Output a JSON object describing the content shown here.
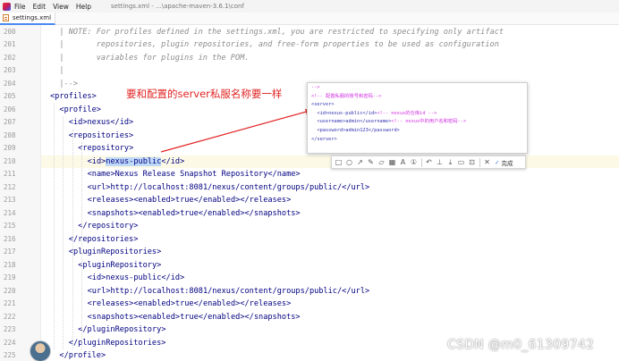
{
  "menubar": {
    "items": [
      "File",
      "Edit",
      "View",
      "Help"
    ],
    "window_title": "settings.xml - ...\\apache-maven-3.6.1\\conf"
  },
  "tab": {
    "label": "settings.xml"
  },
  "annotation": {
    "text": "要和配置的server私服名称要一样"
  },
  "popup": {
    "lines": [
      {
        "kind": "c",
        "text": "-->"
      },
      {
        "kind": "c",
        "text": "<!-- 配置私服的账号和密码-->"
      },
      {
        "kind": "t",
        "text": "<server>"
      },
      {
        "kind": "m",
        "text": "  <id>nexus-public</id>",
        "comment": "<!-- nexus的仓库id -->"
      },
      {
        "kind": "m",
        "text": "  <username>admin</username>",
        "comment": "<!-- nexus中的用户名和密码-->"
      },
      {
        "kind": "t",
        "text": "  <password>admin123</password>"
      },
      {
        "kind": "t",
        "text": "</server>"
      }
    ]
  },
  "toolbar": {
    "tools": [
      "rect-icon",
      "circle-icon",
      "arrow-icon",
      "pen-icon",
      "marker-icon",
      "mosaic-icon",
      "text-icon",
      "sequence-icon",
      "undo-icon",
      "pin-icon",
      "download-icon",
      "save-icon",
      "ocr-icon",
      "close-icon"
    ],
    "tool_glyphs": [
      "□",
      "○",
      "↗",
      "✎",
      "▱",
      "▦",
      "A",
      "①",
      "↶",
      "⊥",
      "⤓",
      "▭",
      "⊡",
      "✕"
    ],
    "done_label": "完成"
  },
  "code": {
    "lines": [
      {
        "num": "200",
        "indent": 0,
        "text": "  | NOTE: For profiles defined in the settings.xml, you are restricted to specifying only artifact",
        "type": "comment"
      },
      {
        "num": "201",
        "indent": 0,
        "text": "  |       repositories, plugin repositories, and free-form properties to be used as configuration",
        "type": "comment"
      },
      {
        "num": "202",
        "indent": 0,
        "text": "  |       variables for plugins in the POM.",
        "type": "comment"
      },
      {
        "num": "203",
        "indent": 0,
        "text": "  |",
        "type": "comment"
      },
      {
        "num": "204",
        "indent": 0,
        "text": "  |-->",
        "type": "comment"
      },
      {
        "num": "205",
        "indent": 0,
        "text": "<profiles>",
        "type": "tag"
      },
      {
        "num": "206",
        "indent": 1,
        "text": "<profile>",
        "type": "tag"
      },
      {
        "num": "207",
        "indent": 2,
        "text": "<id>nexus</id>",
        "type": "tag"
      },
      {
        "num": "208",
        "indent": 2,
        "text": "<repositories>",
        "type": "tag"
      },
      {
        "num": "209",
        "indent": 3,
        "text": "<repository>",
        "type": "tag"
      },
      {
        "num": "210",
        "indent": 4,
        "pre": "<id>",
        "hl": "nexus-public",
        "post": "</id>",
        "type": "tag"
      },
      {
        "num": "211",
        "indent": 4,
        "text": "<name>Nexus Release Snapshot Repository</name>",
        "type": "tag"
      },
      {
        "num": "212",
        "indent": 4,
        "text": "<url>http://localhost:8081/nexus/content/groups/public/</url>",
        "type": "tag"
      },
      {
        "num": "213",
        "indent": 4,
        "text": "<releases><enabled>true</enabled></releases>",
        "type": "tag"
      },
      {
        "num": "214",
        "indent": 4,
        "text": "<snapshots><enabled>true</enabled></snapshots>",
        "type": "tag"
      },
      {
        "num": "215",
        "indent": 3,
        "text": "</repository>",
        "type": "tag"
      },
      {
        "num": "216",
        "indent": 2,
        "text": "</repositories>",
        "type": "tag"
      },
      {
        "num": "217",
        "indent": 2,
        "text": "<pluginRepositories>",
        "type": "tag"
      },
      {
        "num": "218",
        "indent": 3,
        "text": "<pluginRepository>",
        "type": "tag"
      },
      {
        "num": "219",
        "indent": 4,
        "text": "<id>nexus-public</id>",
        "type": "tag"
      },
      {
        "num": "220",
        "indent": 4,
        "text": "<url>http://localhost:8081/nexus/content/groups/public/</url>",
        "type": "tag"
      },
      {
        "num": "221",
        "indent": 4,
        "text": "<releases><enabled>true</enabled></releases>",
        "type": "tag"
      },
      {
        "num": "222",
        "indent": 4,
        "text": "<snapshots><enabled>true</enabled></snapshots>",
        "type": "tag"
      },
      {
        "num": "223",
        "indent": 3,
        "text": "</pluginRepository>",
        "type": "tag"
      },
      {
        "num": "224",
        "indent": 2,
        "text": "</pluginRepositories>",
        "type": "tag"
      },
      {
        "num": "225",
        "indent": 1,
        "text": "</profile>",
        "type": "tag"
      }
    ],
    "current_line": "210"
  },
  "watermark": {
    "text": "CSDN @m0_61309742"
  },
  "colors": {
    "annotation": "#e02424",
    "tag": "#000080",
    "comment": "#8c8c8c",
    "selection": "#bfd9f8",
    "current_line": "#fcfae6"
  }
}
